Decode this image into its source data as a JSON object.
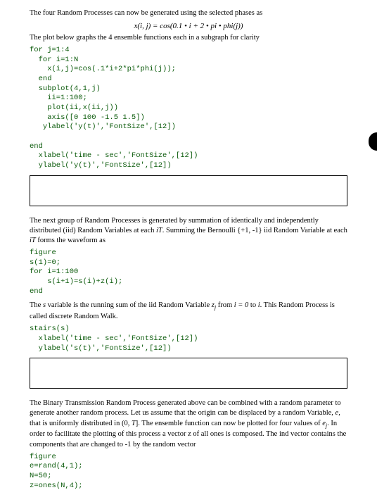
{
  "p1": "The four Random Processes can now be generated using the selected phases as",
  "formula1": "x(i, j) = cos(0.1 • i + 2 • pi • phi(j))",
  "p2": "The plot below graphs the 4 ensemble functions each in a subgraph for clarity",
  "code1": "for j=1:4\n  for i=1:N\n    x(i,j)=cos(.1*i+2*pi*phi(j));\n  end\n  subplot(4,1,j)\n    ii=1:100;\n    plot(ii,x(ii,j))\n    axis([0 100 -1.5 1.5])\n   ylabel('y(t)','FontSize',[12])\n\nend\n  xlabel('time - sec','FontSize',[12])\n  ylabel('y(t)','FontSize',[12])",
  "p3a": "The next group of Random Processes is generated by summation of identically and independently distributed (iid) Random Variables at each ",
  "p3b": "iT",
  "p3c": ".  Summing the Bernoulli {+1, -1} iid Random Variable at each ",
  "p3d": "iT",
  "p3e": " forms the waveform as",
  "code2": "figure\ns(1)=0;\nfor i=1:100\n    s(i+1)=s(i)+z(i);\nend",
  "p4a": "The ",
  "p4b": "s",
  "p4c": " variable is the running sum of the iid Random Variable ",
  "p4d": "z",
  "p4e": "j",
  "p4f": " from ",
  "p4g": "i  = 0",
  "p4h": " to ",
  "p4i": "i",
  "p4j": ".  This Random Process is called discrete Random Walk.",
  "code3": "stairs(s)\n  xlabel('time - sec','FontSize',[12])\n  ylabel('s(t)','FontSize',[12])",
  "p5a": "The Binary Transmission Random Process generated above can be combined with a random parameter to generate another random process.  Let us assume that the origin can be displaced by a random Variable, ",
  "p5b": "e",
  "p5c": ", that is uniformly distributed in (0, ",
  "p5d": "T",
  "p5e": "].  The ensemble function can now be plotted for four values of ",
  "p5f": "e",
  "p5g": "j",
  "p5h": ". In order to facilitate the plotting of this process a vector z of all ones is composed. The ind vector contains the components that are changed to -1 by the random vector",
  "code4": "figure\ne=rand(4,1);\nN=50;\nz=ones(N,4);"
}
